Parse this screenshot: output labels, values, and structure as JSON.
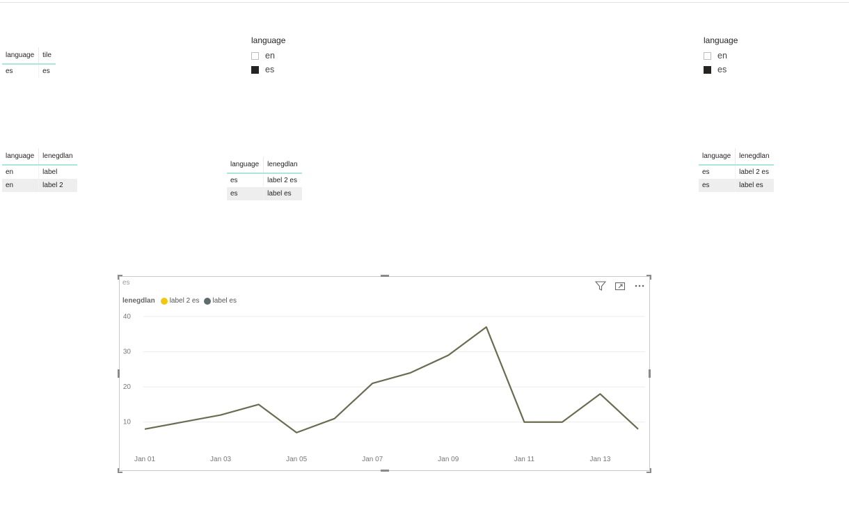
{
  "table1": {
    "headers": [
      "language",
      "tile"
    ],
    "rows": [
      [
        "es",
        "es"
      ]
    ]
  },
  "slicer1": {
    "title": "language",
    "items": [
      {
        "label": "en",
        "checked": false
      },
      {
        "label": "es",
        "checked": true
      }
    ]
  },
  "slicer2": {
    "title": "language",
    "items": [
      {
        "label": "en",
        "checked": false
      },
      {
        "label": "es",
        "checked": true
      }
    ]
  },
  "table2": {
    "headers": [
      "language",
      "lenegdlan"
    ],
    "rows": [
      [
        "en",
        "label"
      ],
      [
        "en",
        "label 2"
      ]
    ]
  },
  "table3": {
    "headers": [
      "language",
      "lenegdlan"
    ],
    "rows": [
      [
        "es",
        "label 2 es"
      ],
      [
        "es",
        "label es"
      ]
    ]
  },
  "table4": {
    "headers": [
      "language",
      "lenegdlan"
    ],
    "rows": [
      [
        "es",
        "label 2 es"
      ],
      [
        "es",
        "label es"
      ]
    ]
  },
  "visual": {
    "title": "es",
    "legend_title": "lenegdlan",
    "legend_items": [
      {
        "name": "label 2 es",
        "color": "#f2c80f"
      },
      {
        "name": "label es",
        "color": "#5f6b6d"
      }
    ],
    "tools": [
      "filter-icon",
      "focus-mode-icon",
      "more-options-icon"
    ]
  },
  "chart_data": {
    "type": "line",
    "x": [
      "Jan 01",
      "Jan 02",
      "Jan 03",
      "Jan 04",
      "Jan 05",
      "Jan 06",
      "Jan 07",
      "Jan 08",
      "Jan 09",
      "Jan 10",
      "Jan 11",
      "Jan 12",
      "Jan 13",
      "Jan 14"
    ],
    "x_tick_labels": [
      "Jan 01",
      "Jan 03",
      "Jan 05",
      "Jan 07",
      "Jan 09",
      "Jan 11",
      "Jan 13"
    ],
    "series": [
      {
        "name": "label es",
        "color": "#6b6b52",
        "values": [
          8,
          10,
          12,
          15,
          7,
          11,
          21,
          24,
          29,
          37,
          10,
          10,
          18,
          8
        ]
      }
    ],
    "ylim": [
      5,
      40
    ],
    "y_ticks": [
      10,
      20,
      30,
      40
    ],
    "grid": true,
    "legend_position": "top-left"
  }
}
